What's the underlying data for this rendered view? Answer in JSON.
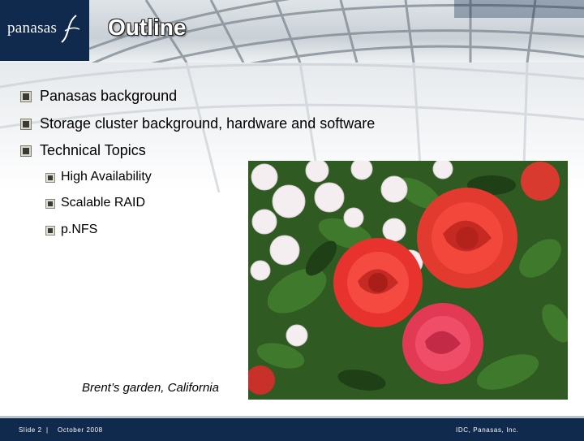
{
  "logo": {
    "text": "panasas"
  },
  "slide": {
    "title": "Outline"
  },
  "bullets": [
    {
      "text": "Panasas background"
    },
    {
      "text": "Storage cluster background, hardware and software"
    },
    {
      "text": "Technical Topics"
    }
  ],
  "sub_bullets": [
    {
      "text": "High Availability"
    },
    {
      "text": "Scalable RAID"
    },
    {
      "text": "p.NFS"
    }
  ],
  "photo": {
    "caption": "Brent’s garden, California"
  },
  "footer": {
    "slide_number": "Slide 2",
    "separator": "|",
    "date": "October 2008",
    "copyright": "IDC, Panasas, Inc."
  },
  "colors": {
    "navy": "#0f2a4c",
    "rose_red": "#e8322e",
    "white_rose": "#f4eef0",
    "leaf": "#2e6b24"
  }
}
